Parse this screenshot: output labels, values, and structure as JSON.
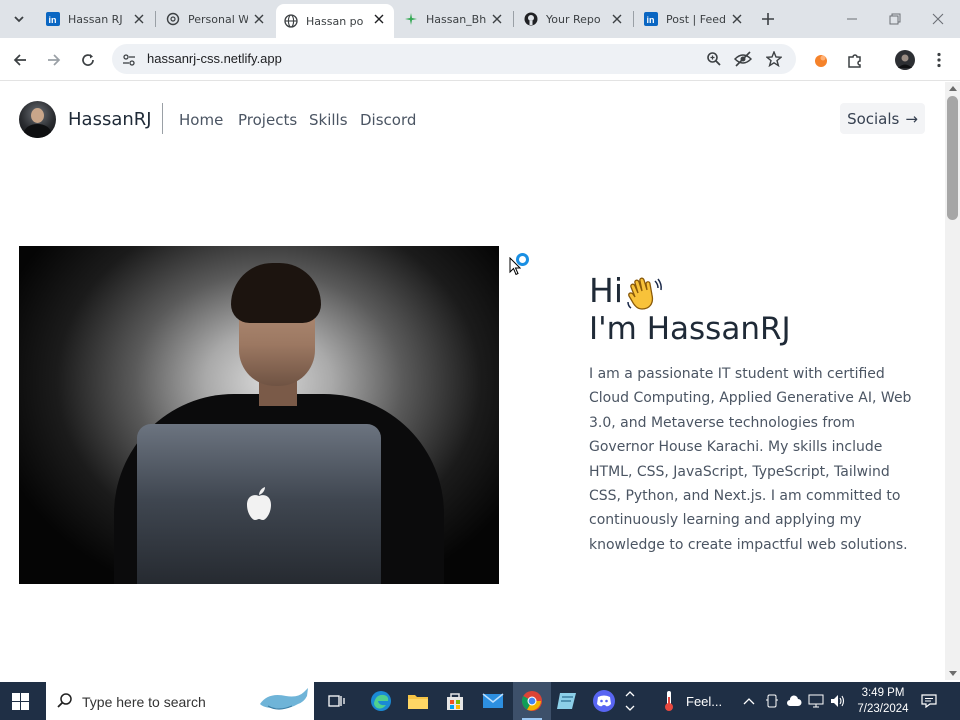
{
  "browser": {
    "tabs": [
      {
        "title": "Hassan RJ",
        "icon": "linkedin-icon",
        "active": false
      },
      {
        "title": "Personal W",
        "icon": "chatgpt-icon",
        "active": false
      },
      {
        "title": "Hassan po",
        "icon": "globe-icon",
        "active": true
      },
      {
        "title": "Hassan_Bh",
        "icon": "leaf-icon",
        "active": false
      },
      {
        "title": "Your Repo",
        "icon": "github-icon",
        "active": false
      },
      {
        "title": "Post | Feed",
        "icon": "linkedin-icon",
        "active": false
      }
    ],
    "url": "hassanrj-css.netlify.app"
  },
  "site": {
    "brand": "HassanRJ",
    "nav": [
      "Home",
      "Projects",
      "Skills",
      "Discord"
    ],
    "socials_label": "Socials",
    "socials_arrow": "→",
    "greeting": "Hi",
    "name_line": "I'm HassanRJ",
    "bio": "I am a passionate IT student with certified Cloud Computing, Applied Generative AI, Web 3.0, and Metaverse technologies from Governor House Karachi. My skills include HTML, CSS, JavaScript, TypeScript, Tailwind CSS, Python, and Next.js. I am committed to continuously learning and applying my knowledge to create impactful web solutions."
  },
  "taskbar": {
    "search_placeholder": "Type here to search",
    "weather": "Feel...",
    "time": "3:49 PM",
    "date": "7/23/2024"
  },
  "colors": {
    "accent_blue": "#1a73e8",
    "taskbar_bg": "#1f2f45",
    "tabstrip_bg": "#dfe3e8"
  }
}
